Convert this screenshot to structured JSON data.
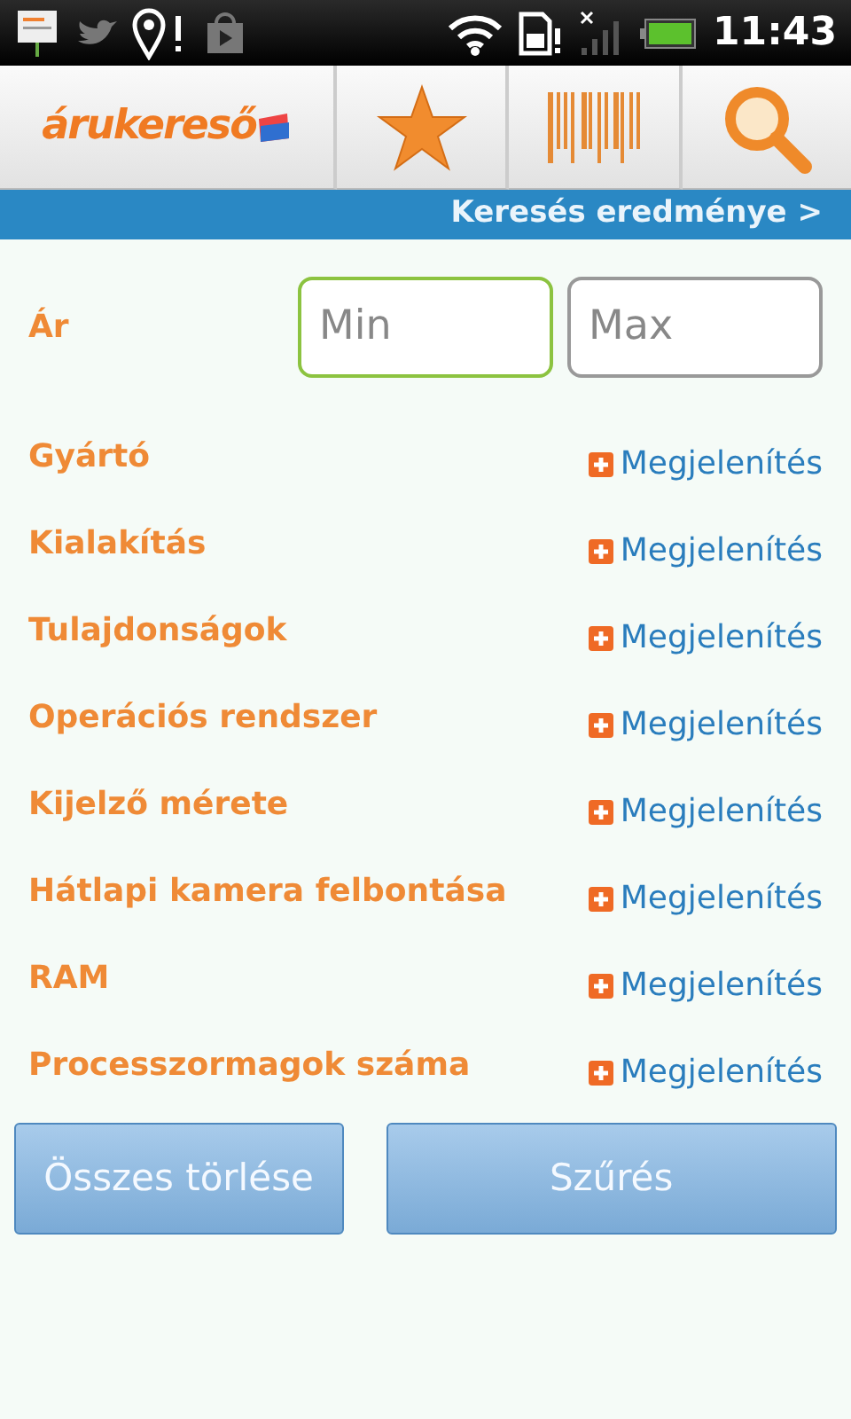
{
  "status_bar": {
    "time": "11:43"
  },
  "toolbar": {
    "logo": "árukereső"
  },
  "results_link": "Keresés eredménye >",
  "price": {
    "label": "Ár",
    "min": {
      "placeholder": "Min",
      "focused": true
    },
    "max": {
      "placeholder": "Max",
      "focused": false
    }
  },
  "filters": [
    {
      "label": "Gyártó",
      "action": "Megjelenítés"
    },
    {
      "label": "Kialakítás",
      "action": "Megjelenítés"
    },
    {
      "label": "Tulajdonságok",
      "action": "Megjelenítés"
    },
    {
      "label": "Operációs rendszer",
      "action": "Megjelenítés"
    },
    {
      "label": "Kijelző mérete",
      "action": "Megjelenítés"
    },
    {
      "label": "Hátlapi kamera felbontása",
      "action": "Megjelenítés"
    },
    {
      "label": "RAM",
      "action": "Megjelenítés"
    },
    {
      "label": "Processzormagok száma",
      "action": "Megjelenítés"
    }
  ],
  "buttons": [
    "Összes törlése",
    "Szűrés"
  ]
}
